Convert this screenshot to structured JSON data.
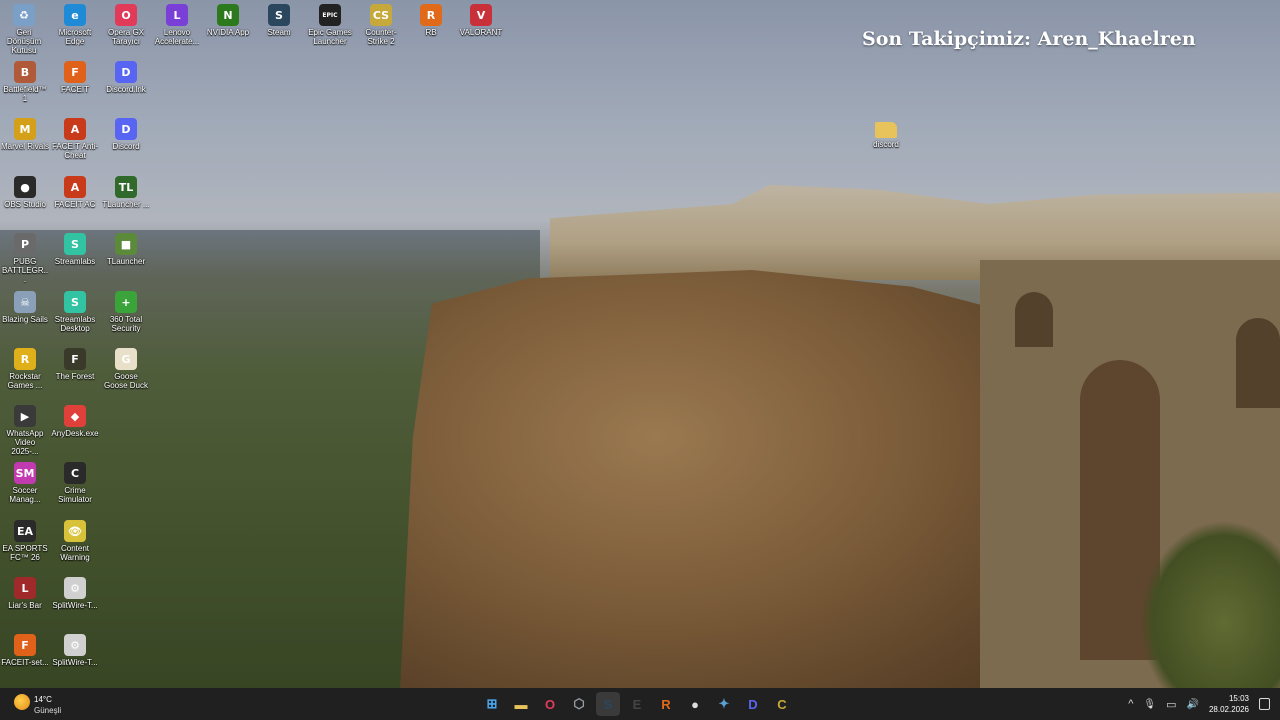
{
  "stream_overlay": {
    "follower_text": "Son Takipçimiz: Aren_Khaelren"
  },
  "desktop_icons": [
    {
      "id": "i1",
      "label": "Geri Dönüşüm Kutusu",
      "icon": "recycle-bin-icon",
      "color": "#7aa0c8",
      "glyph": "♻"
    },
    {
      "id": "i2",
      "label": "Microsoft Edge",
      "icon": "edge-icon",
      "color": "#1f8ad6",
      "glyph": "e"
    },
    {
      "id": "i3",
      "label": "Opera GX Tarayıcı",
      "icon": "opera-gx-icon",
      "color": "#e23b5a",
      "glyph": "O"
    },
    {
      "id": "i4",
      "label": "Lenovo Accelerate...",
      "icon": "lenovo-icon",
      "color": "#7a3fd6",
      "glyph": "L"
    },
    {
      "id": "i5",
      "label": "NVIDIA App",
      "icon": "nvidia-icon",
      "color": "#2d7a1e",
      "glyph": "N"
    },
    {
      "id": "i6",
      "label": "Steam",
      "icon": "steam-icon",
      "color": "#2a475e",
      "glyph": "S"
    },
    {
      "id": "i7",
      "label": "Epic Games Launcher",
      "icon": "epic-games-icon",
      "color": "#222222",
      "glyph": "EPIC"
    },
    {
      "id": "i8",
      "label": "Counter-Strike 2",
      "icon": "cs2-icon",
      "color": "#c7a83a",
      "glyph": "CS"
    },
    {
      "id": "i9",
      "label": "RB",
      "icon": "rb-icon",
      "color": "#e06a1a",
      "glyph": "R"
    },
    {
      "id": "i10",
      "label": "VALORANT",
      "icon": "valorant-icon",
      "color": "#c8303a",
      "glyph": "V"
    },
    {
      "id": "i11",
      "label": "Battlefield™ 1",
      "icon": "battlefield-icon",
      "color": "#b05a3a",
      "glyph": "B"
    },
    {
      "id": "i12",
      "label": "FACEIT",
      "icon": "faceit-icon",
      "color": "#e0621a",
      "glyph": "F"
    },
    {
      "id": "i13",
      "label": "Discord.lnk",
      "icon": "discord-icon",
      "color": "#5865f2",
      "glyph": "D"
    },
    {
      "id": "i14",
      "label": "Marvel Rivals",
      "icon": "marvel-rivals-icon",
      "color": "#d4a01a",
      "glyph": "M"
    },
    {
      "id": "i15",
      "label": "FACEIT Anti-Cheat",
      "icon": "faceit-ac-icon",
      "color": "#c83a1a",
      "glyph": "A"
    },
    {
      "id": "i16",
      "label": "Discord",
      "icon": "discord-icon",
      "color": "#5865f2",
      "glyph": "D"
    },
    {
      "id": "i17",
      "label": "discord",
      "icon": "folder-icon",
      "color": "#e8c25a",
      "glyph": ""
    },
    {
      "id": "i18",
      "label": "OBS Studio",
      "icon": "obs-icon",
      "color": "#2a2a2a",
      "glyph": "●"
    },
    {
      "id": "i19",
      "label": "FACEIT AC",
      "icon": "faceit-ac-icon",
      "color": "#c83a1a",
      "glyph": "A"
    },
    {
      "id": "i20",
      "label": "TLauncher ...",
      "icon": "tlauncher-icon",
      "color": "#2f6a2a",
      "glyph": "TL"
    },
    {
      "id": "i21",
      "label": "PUBG BATTLEGR...",
      "icon": "pubg-icon",
      "color": "#6a6a6a",
      "glyph": "P"
    },
    {
      "id": "i22",
      "label": "Streamlabs",
      "icon": "streamlabs-icon",
      "color": "#31c3a2",
      "glyph": "S"
    },
    {
      "id": "i23",
      "label": "TLauncher",
      "icon": "minecraft-icon",
      "color": "#5a8a3a",
      "glyph": "■"
    },
    {
      "id": "i24",
      "label": "Blazing Sails",
      "icon": "blazing-sails-icon",
      "color": "#8aa0b8",
      "glyph": "☠"
    },
    {
      "id": "i25",
      "label": "Streamlabs Desktop",
      "icon": "streamlabs-icon",
      "color": "#31c3a2",
      "glyph": "S"
    },
    {
      "id": "i26",
      "label": "360 Total Security",
      "icon": "360-security-icon",
      "color": "#3aa33a",
      "glyph": "+"
    },
    {
      "id": "i27",
      "label": "Rockstar Games ...",
      "icon": "rockstar-icon",
      "color": "#e0b01a",
      "glyph": "R"
    },
    {
      "id": "i28",
      "label": "The Forest",
      "icon": "the-forest-icon",
      "color": "#3a3a2a",
      "glyph": "F"
    },
    {
      "id": "i29",
      "label": "Goose Goose Duck",
      "icon": "goose-goose-duck-icon",
      "color": "#e8e0c8",
      "glyph": "G"
    },
    {
      "id": "i30",
      "label": "WhatsApp Video 2025-...",
      "icon": "video-file-icon",
      "color": "#3a3a3a",
      "glyph": "▶"
    },
    {
      "id": "i31",
      "label": "AnyDesk.exe",
      "icon": "anydesk-icon",
      "color": "#e0403a",
      "glyph": "◆"
    },
    {
      "id": "i32",
      "label": "Soccer Manag...",
      "icon": "soccer-manager-icon",
      "color": "#c23ab0",
      "glyph": "SM"
    },
    {
      "id": "i33",
      "label": "Crime Simulator",
      "icon": "crime-simulator-icon",
      "color": "#2a2a2a",
      "glyph": "C"
    },
    {
      "id": "i34",
      "label": "EA SPORTS FC™ 26",
      "icon": "ea-fc-icon",
      "color": "#2a2a2a",
      "glyph": "EA"
    },
    {
      "id": "i35",
      "label": "Content Warning",
      "icon": "content-warning-icon",
      "color": "#d8c23a",
      "glyph": "👁"
    },
    {
      "id": "i36",
      "label": "Liar's Bar",
      "icon": "liars-bar-icon",
      "color": "#a02a2a",
      "glyph": "L"
    },
    {
      "id": "i37",
      "label": "SplitWire-T...",
      "icon": "splitwire-icon",
      "color": "#d0d0d0",
      "glyph": "⚙"
    },
    {
      "id": "i38",
      "label": "FACEIT-set...",
      "icon": "faceit-icon",
      "color": "#e0621a",
      "glyph": "F"
    },
    {
      "id": "i39",
      "label": "SplitWire-T...",
      "icon": "splitwire-icon",
      "color": "#d0d0d0",
      "glyph": "⚙"
    }
  ],
  "taskbar": {
    "weather": {
      "temp": "14°C",
      "condition": "Güneşli",
      "icon": "weather-sun-icon"
    },
    "apps": [
      {
        "name": "start-button",
        "glyph": "⊞",
        "color": "#4aa8f0"
      },
      {
        "name": "file-explorer-icon",
        "glyph": "▬",
        "color": "#e8c25a"
      },
      {
        "name": "opera-gx-taskbar-icon",
        "glyph": "O",
        "color": "#e23b5a"
      },
      {
        "name": "unknown-app-icon",
        "glyph": "⬡",
        "color": "#9aa0a8"
      },
      {
        "name": "steam-taskbar-icon",
        "glyph": "S",
        "color": "#2a475e"
      },
      {
        "name": "epic-taskbar-icon",
        "glyph": "E",
        "color": "#444"
      },
      {
        "name": "rb-taskbar-icon",
        "glyph": "R",
        "color": "#e06a1a"
      },
      {
        "name": "obs-taskbar-icon",
        "glyph": "●",
        "color": "#ddd"
      },
      {
        "name": "network-app-icon",
        "glyph": "✦",
        "color": "#5aa0d0"
      },
      {
        "name": "discord-taskbar-icon",
        "glyph": "D",
        "color": "#5865f2"
      },
      {
        "name": "cs2-taskbar-icon",
        "glyph": "C",
        "color": "#c7a83a"
      }
    ],
    "tray": {
      "chevron": "^",
      "mic": "🎙",
      "network": "▭",
      "volume": "🔊",
      "time": "15:03",
      "date": "28.02.2026"
    }
  }
}
